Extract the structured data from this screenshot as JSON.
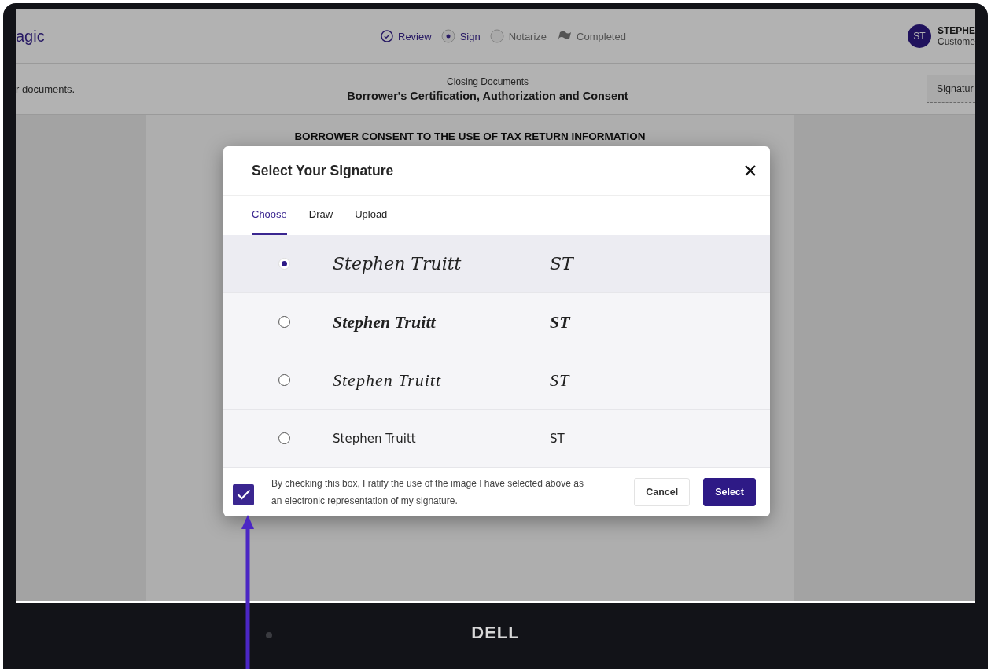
{
  "app": {
    "logo": "agic",
    "steps": [
      {
        "label": "Review",
        "kind": "done"
      },
      {
        "label": "Sign",
        "kind": "current"
      },
      {
        "label": "Notarize",
        "kind": "pending"
      },
      {
        "label": "Completed",
        "kind": "final"
      }
    ],
    "user": {
      "initials": "ST",
      "name": "STEPHE",
      "role": "Custome"
    },
    "subheader": {
      "left_text": "r documents.",
      "section": "Closing Documents",
      "title": "Borrower's Certification, Authorization and Consent",
      "button": "Signatur"
    },
    "document": {
      "heading": "BORROWER CONSENT TO THE USE OF TAX RETURN INFORMATION"
    }
  },
  "dialog": {
    "title": "Select Your Signature",
    "tabs": [
      {
        "label": "Choose",
        "selected": true
      },
      {
        "label": "Draw",
        "selected": false
      },
      {
        "label": "Upload",
        "selected": false
      }
    ],
    "signatures": [
      {
        "kind": "script",
        "name": "Stephen Truitt",
        "initials": "ST",
        "selected": true
      },
      {
        "kind": "brush",
        "name": "Stephen Truitt",
        "initials": "ST",
        "selected": false
      },
      {
        "kind": "flourish",
        "name": "Stephen Truitt",
        "initials": "ST",
        "selected": false
      },
      {
        "kind": "marker",
        "name": "Stephen Truitt",
        "initials": "ST",
        "selected": false
      }
    ],
    "consent": {
      "checked": true,
      "text": "By checking this box, I ratify the use of the image I have selected above as an electronic representation of my signature."
    },
    "buttons": [
      {
        "kind": "secondary",
        "label": "Cancel"
      },
      {
        "kind": "primary",
        "label": "Select"
      }
    ]
  },
  "monitor": {
    "logo": "DELL"
  }
}
